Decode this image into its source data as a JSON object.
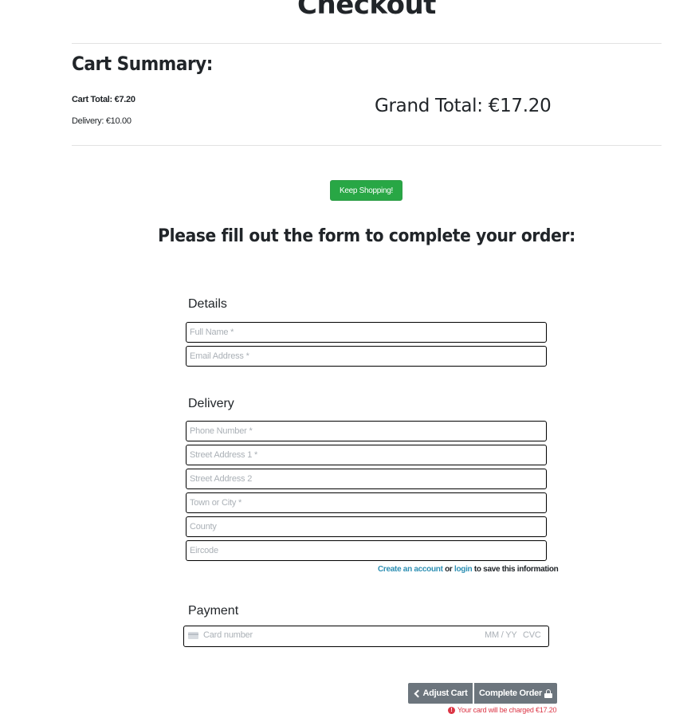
{
  "page": {
    "title": "Checkout"
  },
  "cart_summary": {
    "heading": "Cart Summary:",
    "cart_total": "Cart Total: €7.20",
    "delivery": "Delivery: €10.00",
    "grand_total": "Grand Total: €17.20"
  },
  "keep_shopping": {
    "label": "Keep Shopping!"
  },
  "form": {
    "heading": "Please fill out the form to complete your order:",
    "details": {
      "legend": "Details",
      "full_name_placeholder": "Full Name *",
      "email_placeholder": "Email Address *"
    },
    "delivery": {
      "legend": "Delivery",
      "phone_placeholder": "Phone Number *",
      "street1_placeholder": "Street Address 1 *",
      "street2_placeholder": "Street Address 2",
      "town_placeholder": "Town or City *",
      "county_placeholder": "County",
      "eircode_placeholder": "Eircode"
    },
    "save_info": {
      "create_account": "Create an account",
      "or": "or",
      "login": "login",
      "suffix": "to save this information"
    },
    "payment": {
      "legend": "Payment",
      "card_number_placeholder": "Card number",
      "expiry_placeholder": "MM / YY",
      "cvc_placeholder": "CVC",
      "card_icon": "credit-card-icon"
    }
  },
  "actions": {
    "adjust_cart_label": "Adjust Cart",
    "complete_order_label": "Complete Order",
    "adjust_icon": "chevron-left-icon",
    "complete_icon": "lock-icon",
    "charge_note": "Your card will be charged €17.20",
    "charge_icon": "exclamation-circle-icon"
  },
  "colors": {
    "success_button": "#28a745",
    "secondary_button": "#6c757d",
    "link": "#2d8fb3",
    "danger": "#dc3545"
  }
}
